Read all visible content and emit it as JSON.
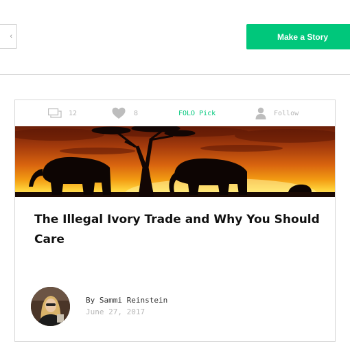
{
  "header": {
    "left_button_label": "‹",
    "make_story_label": "Make a Story",
    "accent_color": "#00c77b"
  },
  "card": {
    "stats": {
      "comments_count": "12",
      "likes_count": "8",
      "pick_label": "FOLO Pick",
      "follow_label": "Follow"
    },
    "hero_image": "elephants-at-sunset",
    "title": "The Illegal Ivory Trade and Why You Should Care",
    "author_line": "By Sammi Reinstein",
    "date": "June 27, 2017"
  }
}
